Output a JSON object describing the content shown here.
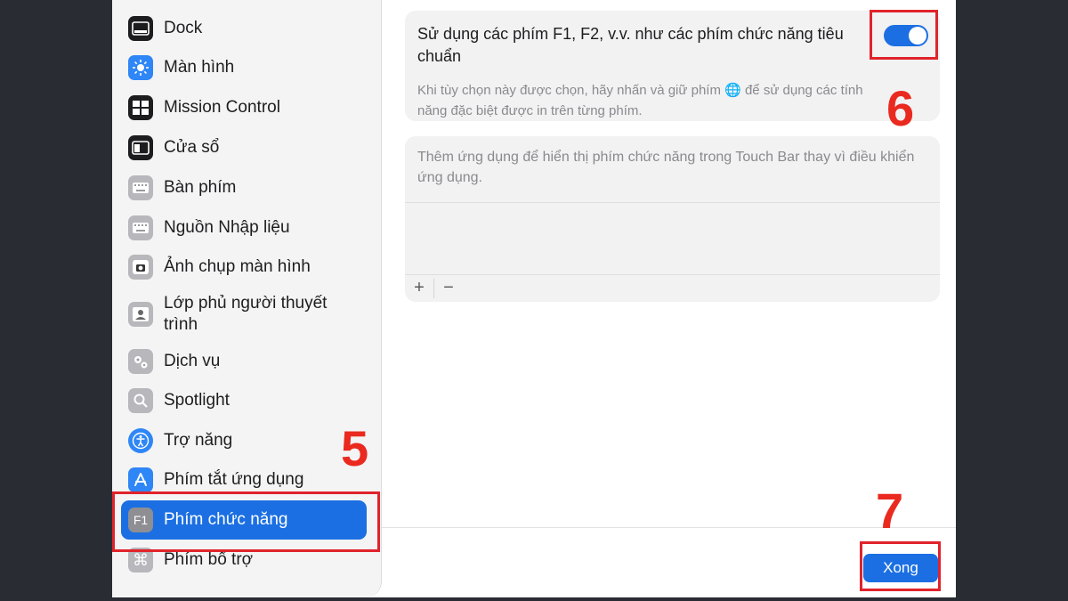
{
  "sidebar": {
    "items": [
      {
        "label": "Dock",
        "icon": "dock-icon"
      },
      {
        "label": "Màn hình",
        "icon": "brightness-icon"
      },
      {
        "label": "Mission Control",
        "icon": "mission-control-icon"
      },
      {
        "label": "Cửa sổ",
        "icon": "window-icon"
      },
      {
        "label": "Bàn phím",
        "icon": "keyboard-icon"
      },
      {
        "label": "Nguồn Nhập liệu",
        "icon": "keyboard-icon"
      },
      {
        "label": "Ảnh chụp màn hình",
        "icon": "camera-icon"
      },
      {
        "label": "Lớp phủ người thuyết trình",
        "icon": "presenter-icon"
      },
      {
        "label": "Dịch vụ",
        "icon": "gears-icon"
      },
      {
        "label": "Spotlight",
        "icon": "search-icon"
      },
      {
        "label": "Trợ năng",
        "icon": "accessibility-icon"
      },
      {
        "label": "Phím tắt ứng dụng",
        "icon": "app-store-icon"
      },
      {
        "label": "Phím chức năng",
        "icon": "f1-key-icon",
        "active": true
      },
      {
        "label": "Phím bổ trợ",
        "icon": "command-icon"
      }
    ],
    "f1_glyph": "F1",
    "cmd_glyph": "⌘"
  },
  "main": {
    "fn_setting": {
      "title": "Sử dụng các phím F1, F2, v.v. như các phím chức năng tiêu chuẩn",
      "description": "Khi tùy chọn này được chọn, hãy nhấn và giữ phím 🌐 để sử dụng các tính năng đặc biệt được in trên từng phím.",
      "enabled": true
    },
    "touchbar": {
      "description": "Thêm ứng dụng để hiển thị phím chức năng trong Touch Bar thay vì điều khiển ứng dụng.",
      "add_label": "+",
      "remove_label": "−"
    },
    "done_label": "Xong"
  },
  "annotations": {
    "step5": "5",
    "step6": "6",
    "step7": "7",
    "color": "#e0232b"
  },
  "colors": {
    "accent": "#1b6fe3",
    "background": "#2a2c34"
  }
}
